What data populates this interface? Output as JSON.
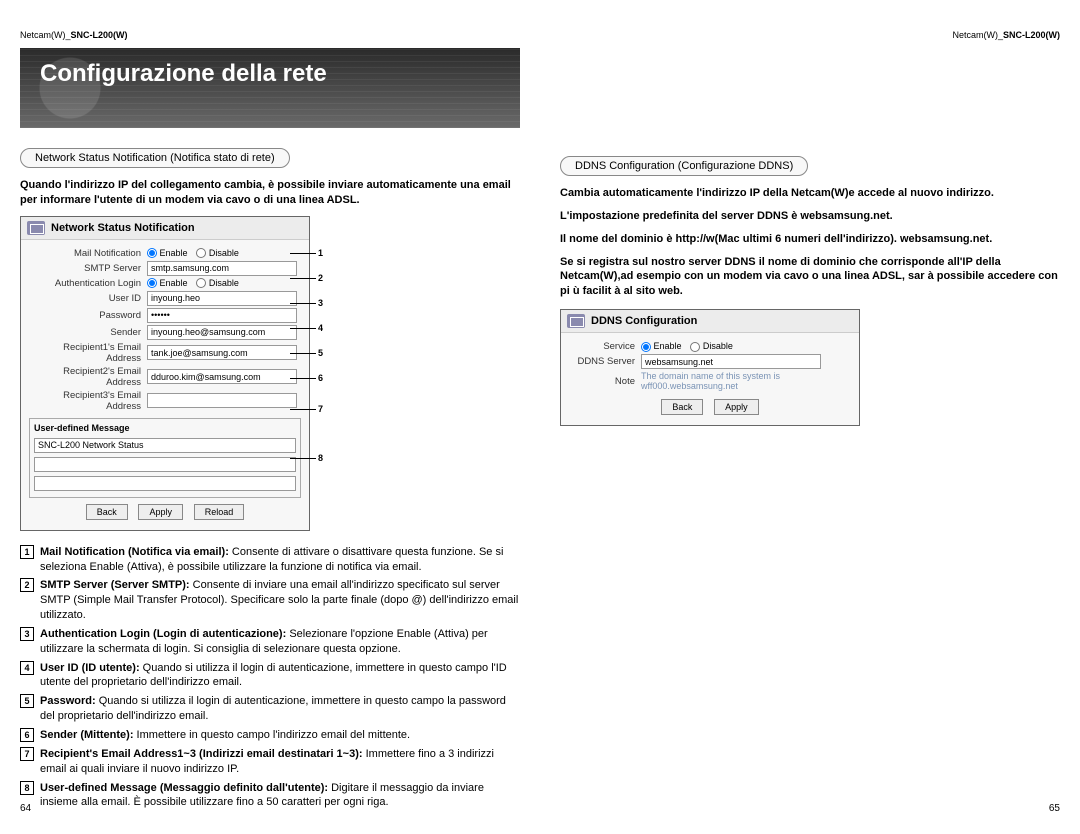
{
  "header": {
    "model_prefix": "Netcam(W)_",
    "model": "SNC-L200(W)"
  },
  "banner": {
    "title": "Configurazione della rete"
  },
  "left": {
    "pill": "Network Status Notification (Notifica stato di rete)",
    "intro": "Quando l'indirizzo IP del collegamento cambia, è possibile inviare automaticamente una email per informare l'utente di un modem via cavo o di una linea ADSL.",
    "panel": {
      "title": "Network Status Notification",
      "mail_notif_label": "Mail Notification",
      "enable": "Enable",
      "disable": "Disable",
      "smtp_label": "SMTP Server",
      "smtp_val": "smtp.samsung.com",
      "auth_label": "Authentication Login",
      "userid_label": "User ID",
      "userid_val": "inyoung.heo",
      "password_label": "Password",
      "password_val": "••••••",
      "sender_label": "Sender",
      "sender_val": "inyoung.heo@samsung.com",
      "r1_label": "Recipient1's Email Address",
      "r1_val": "tank.joe@samsung.com",
      "r2_label": "Recipient2's Email Address",
      "r2_val": "dduroo.kim@samsung.com",
      "r3_label": "Recipient3's Email Address",
      "r3_val": "",
      "msg_legend": "User-defined Message",
      "msg_val": "SNC-L200 Network Status",
      "btn_back": "Back",
      "btn_apply": "Apply",
      "btn_reload": "Reload"
    },
    "callouts": [
      "1",
      "2",
      "3",
      "4",
      "5",
      "6",
      "7",
      "8"
    ],
    "defs": [
      {
        "n": "1",
        "title": "Mail Notification (Notifica via email):",
        "body": " Consente di attivare o disattivare questa funzione. Se si seleziona Enable (Attiva), è possibile utilizzare la funzione di notifica via email."
      },
      {
        "n": "2",
        "title": "SMTP Server (Server SMTP):",
        "body": " Consente di inviare una email all'indirizzo specificato sul server SMTP (Simple Mail Transfer Protocol). Specificare solo la parte finale (dopo @) dell'indirizzo email utilizzato."
      },
      {
        "n": "3",
        "title": "Authentication Login (Login di autenticazione):",
        "body": " Selezionare l'opzione Enable (Attiva) per utilizzare la schermata di login. Si consiglia di selezionare questa opzione."
      },
      {
        "n": "4",
        "title": "User ID (ID utente):",
        "body": " Quando si utilizza il login di autenticazione, immettere in questo campo l'ID utente del proprietario dell'indirizzo email."
      },
      {
        "n": "5",
        "title": "Password:",
        "body": " Quando si utilizza il login di autenticazione, immettere in questo campo la password del proprietario dell'indirizzo email."
      },
      {
        "n": "6",
        "title": "Sender (Mittente):",
        "body": " Immettere in questo campo l'indirizzo email del mittente."
      },
      {
        "n": "7",
        "title": "Recipient's Email Address1~3 (Indirizzi email destinatari 1~3):",
        "body": " Immettere fino a 3 indirizzi email ai quali inviare il nuovo indirizzo IP."
      },
      {
        "n": "8",
        "title": "User-defined Message (Messaggio definito dall'utente):",
        "body": " Digitare il messaggio da inviare insieme alla email. È possibile utilizzare fino a 50 caratteri per ogni riga."
      }
    ]
  },
  "right": {
    "pill": "DDNS Configuration (Configurazione DDNS)",
    "p1": "Cambia automaticamente l'indirizzo IP della Netcam(W)e accede al nuovo indirizzo.",
    "p2": "L'impostazione predefinita del server DDNS è websamsung.net.",
    "p3": "Il nome del dominio è http://w(Mac ultimi 6 numeri dell'indirizzo). websamsung.net.",
    "p4": "Se si registra sul nostro server DDNS il nome di dominio che corrisponde all'IP della Netcam(W),ad esempio con un modem via cavo o una linea ADSL, sar à possibile accedere con pi ù facilit à al sito web.",
    "panel": {
      "title": "DDNS Configuration",
      "service_label": "Service",
      "enable": "Enable",
      "disable": "Disable",
      "server_label": "DDNS Server",
      "server_val": "websamsung.net",
      "note_label": "Note",
      "note_line1": "The domain name of this system is",
      "note_line2": "wff000.websamsung.net",
      "btn_back": "Back",
      "btn_apply": "Apply"
    }
  },
  "pages": {
    "left": "64",
    "right": "65"
  }
}
